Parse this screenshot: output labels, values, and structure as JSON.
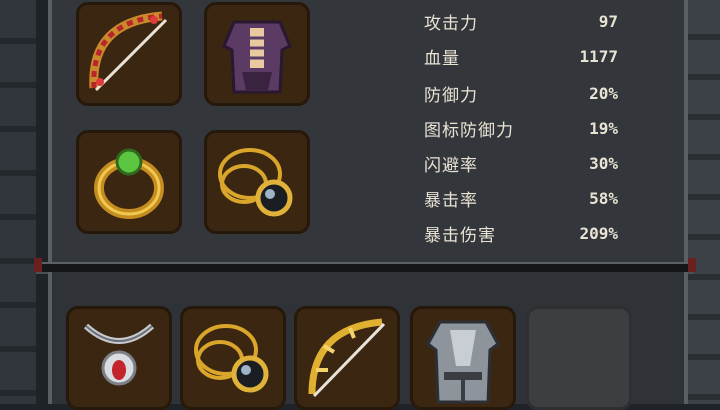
{
  "equipped": [
    {
      "slot": "weapon",
      "icon": "ruby-bow-icon"
    },
    {
      "slot": "armor",
      "icon": "purple-robe-icon"
    },
    {
      "slot": "ring",
      "icon": "emerald-ring-icon"
    },
    {
      "slot": "amulet",
      "icon": "gold-chain-amulet-icon"
    }
  ],
  "stats": [
    {
      "label": "攻击力",
      "value": "97"
    },
    {
      "label": "血量",
      "value": "1177"
    },
    {
      "label": "防御力",
      "value": "20%"
    },
    {
      "label": "图标防御力",
      "value": "19%"
    },
    {
      "label": "闪避率",
      "value": "30%"
    },
    {
      "label": "暴击率",
      "value": "58%"
    },
    {
      "label": "暴击伤害",
      "value": "209%"
    }
  ],
  "inventory": [
    {
      "icon": "ruby-pendant-icon"
    },
    {
      "icon": "gold-chain-amulet-icon"
    },
    {
      "icon": "golden-bow-icon"
    },
    {
      "icon": "steel-armor-icon"
    },
    {
      "icon": "empty-slot"
    }
  ],
  "colors": {
    "slot_bg": "#3b2611",
    "panel_bg": "#33373c",
    "text": "#e9e3d4"
  }
}
